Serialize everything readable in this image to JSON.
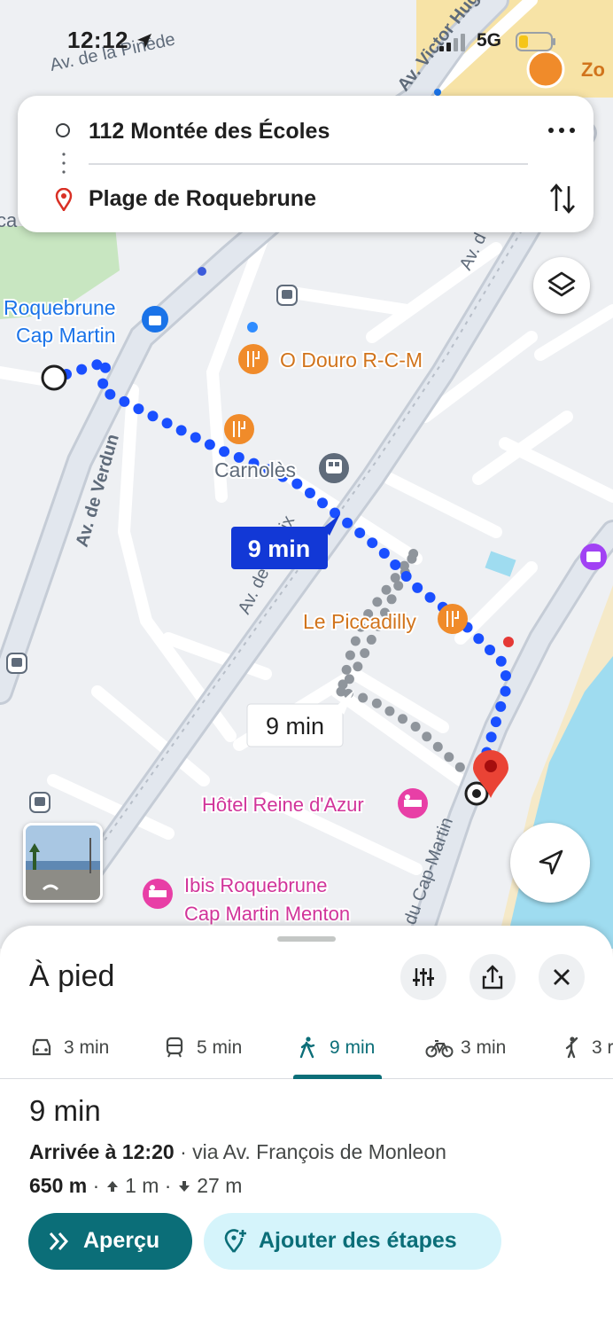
{
  "status_bar": {
    "time": "12:12",
    "network": "5G"
  },
  "route_card": {
    "origin": "112 Montée des Écoles",
    "destination": "Plage de Roquebrune"
  },
  "map": {
    "labels": {
      "street_top_left": "Av. de la Pinède",
      "street_top_right": "Av. Victor Hugo",
      "zone_label": "Zo",
      "place_left_partial": "ca",
      "roquebrune_1": "Roquebrune",
      "roquebrune_2": "Cap Martin",
      "av_verdun": "Av. de Verdun",
      "o_douro": "O Douro R-C-M",
      "carnoles": "Carnolès",
      "av_paix": "Av. de la Paix",
      "av_right_top": "Av. d",
      "le_piccadilly": "Le Piccadilly",
      "hotel_reine": "Hôtel Reine d'Azur",
      "ibis_1": "Ibis Roquebrune",
      "ibis_2": "Cap Martin Menton",
      "cap_martin_road": "du Cap-Martin"
    },
    "route_label_primary": "9 min",
    "route_label_alt": "9 min"
  },
  "sheet": {
    "title": "À pied",
    "modes": [
      {
        "icon": "car-icon",
        "label": "3 min"
      },
      {
        "icon": "transit-icon",
        "label": "5 min"
      },
      {
        "icon": "walk-icon",
        "label": "9 min"
      },
      {
        "icon": "bike-icon",
        "label": "3 min"
      },
      {
        "icon": "ride-icon",
        "label": "3 r"
      }
    ],
    "active_mode_index": 2,
    "duration": "9 min",
    "arrival_bold": "Arrivée à 12:20",
    "arrival_via": " · via Av. François de Monleon",
    "distance": "650 m",
    "ascent": "1 m",
    "descent": "27 m",
    "apercu_label": "Aperçu",
    "etapes_label": "Ajouter des étapes"
  },
  "colors": {
    "route_blue": "#1a4fff",
    "accent_teal": "#0b6e78",
    "food_orange": "#f08b2a",
    "hotel_pink": "#e83fa6",
    "water": "#9fdcf0",
    "park": "#c8e6c1"
  }
}
